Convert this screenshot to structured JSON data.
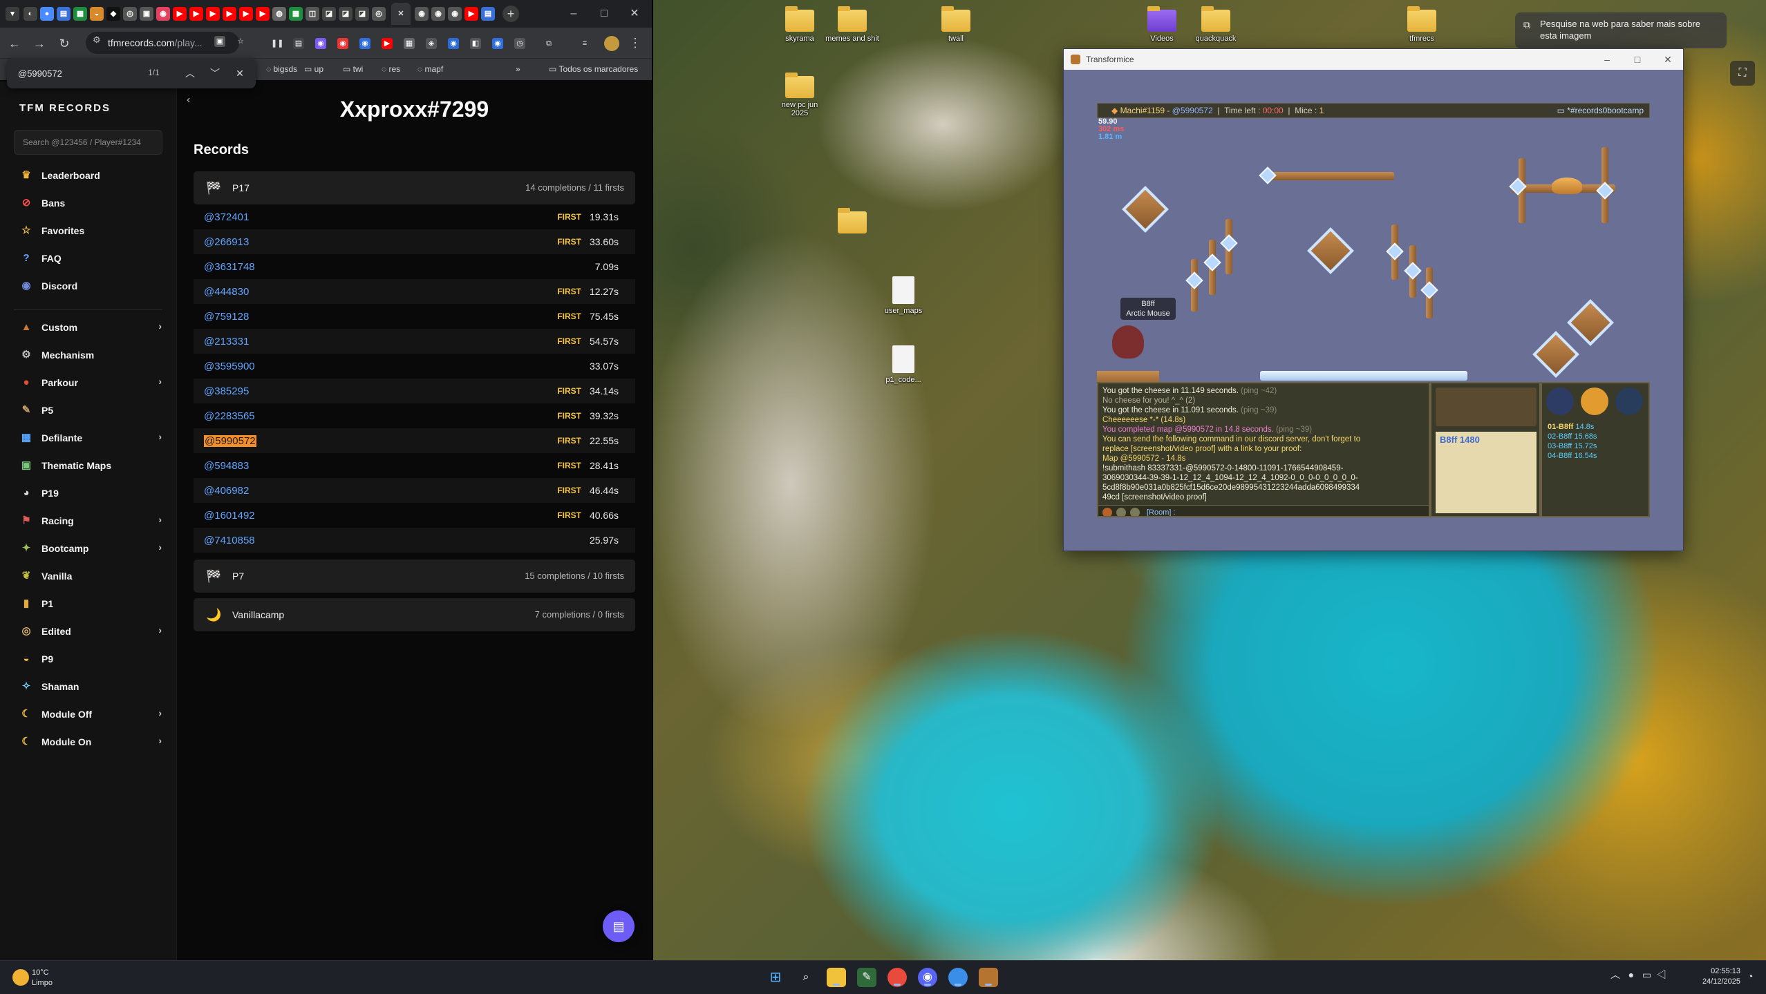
{
  "browser": {
    "url_host": "tfmrecords.com",
    "url_path": "/play...",
    "find": {
      "query": "@5990572",
      "count": "1/1"
    },
    "bookmarks": [
      "bigsds",
      "up",
      "twi",
      "res",
      "mapf"
    ],
    "all_bookmarks": "Todos os marcadores",
    "window_controls": {
      "minimize": "–",
      "maximize": "□",
      "close": "✕"
    }
  },
  "sidebar": {
    "brand": "TFM RECORDS",
    "search_placeholder": "Search @123456 / Player#1234",
    "items_top": [
      {
        "label": "Leaderboard",
        "icon": "crown-icon",
        "glyph": "♛",
        "color": "#f0b43c"
      },
      {
        "label": "Bans",
        "icon": "ban-icon",
        "glyph": "⊘",
        "color": "#ff4d4d"
      },
      {
        "label": "Favorites",
        "icon": "star-icon",
        "glyph": "☆",
        "color": "#f4c542"
      },
      {
        "label": "FAQ",
        "icon": "question-icon",
        "glyph": "?",
        "color": "#6aa3ff"
      },
      {
        "label": "Discord",
        "icon": "discord-icon",
        "glyph": "◉",
        "color": "#7289da"
      }
    ],
    "items_categories": [
      {
        "label": "Custom",
        "icon": "custom-icon",
        "glyph": "▲",
        "color": "#c77a3a",
        "chevron": true
      },
      {
        "label": "Mechanism",
        "icon": "gear-icon",
        "glyph": "⚙",
        "color": "#bdbdbd",
        "chevron": false
      },
      {
        "label": "Parkour",
        "icon": "parkour-icon",
        "glyph": "●",
        "color": "#e0522f",
        "chevron": true
      },
      {
        "label": "P5",
        "icon": "brush-icon",
        "glyph": "✎",
        "color": "#c8a16a",
        "chevron": false
      },
      {
        "label": "Defilante",
        "icon": "defilante-icon",
        "glyph": "▦",
        "color": "#59a7ff",
        "chevron": true
      },
      {
        "label": "Thematic Maps",
        "icon": "map-icon",
        "glyph": "▣",
        "color": "#7cc47c",
        "chevron": false
      },
      {
        "label": "P19",
        "icon": "p19-icon",
        "glyph": "◕",
        "color": "#dcdcdc",
        "chevron": false
      },
      {
        "label": "Racing",
        "icon": "racing-icon",
        "glyph": "⚑",
        "color": "#e05a5a",
        "chevron": true
      },
      {
        "label": "Bootcamp",
        "icon": "bootcamp-icon",
        "glyph": "✦",
        "color": "#9fbf5a",
        "chevron": true
      },
      {
        "label": "Vanilla",
        "icon": "vanilla-icon",
        "glyph": "❦",
        "color": "#c2c23a",
        "chevron": false
      },
      {
        "label": "P1",
        "icon": "lock-icon",
        "glyph": "▮",
        "color": "#e6a93a",
        "chevron": false
      },
      {
        "label": "Edited",
        "icon": "edited-icon",
        "glyph": "◎",
        "color": "#d8b26a",
        "chevron": true
      },
      {
        "label": "P9",
        "icon": "cheese-icon",
        "glyph": "◒",
        "color": "#f0b44a",
        "chevron": false
      },
      {
        "label": "Shaman",
        "icon": "feather-icon",
        "glyph": "✧",
        "color": "#7fd4ff",
        "chevron": false
      },
      {
        "label": "Module Off",
        "icon": "moon-icon",
        "glyph": "☾",
        "color": "#f0c23c",
        "chevron": true
      },
      {
        "label": "Module On",
        "icon": "moon-icon",
        "glyph": "☾",
        "color": "#f0c23c",
        "chevron": true
      }
    ]
  },
  "main": {
    "player": "Xxproxx#7299",
    "section_title": "Records",
    "groups": [
      {
        "name": "P17",
        "stats": "14 completions / 11 firsts",
        "icon": "checkered-flag-icon",
        "glyph": "🏁"
      },
      {
        "name": "P7",
        "stats": "15 completions / 10 firsts",
        "icon": "checkered-flag-icon",
        "glyph": "🏁"
      },
      {
        "name": "Vanillacamp",
        "stats": "7 completions / 0 firsts",
        "icon": "moon-icon",
        "glyph": "🌙"
      }
    ],
    "records": [
      {
        "code": "@372401",
        "first": "FIRST",
        "time": "19.31s"
      },
      {
        "code": "@266913",
        "first": "FIRST",
        "time": "33.60s"
      },
      {
        "code": "@3631748",
        "first": "",
        "time": "7.09s"
      },
      {
        "code": "@444830",
        "first": "FIRST",
        "time": "12.27s"
      },
      {
        "code": "@759128",
        "first": "FIRST",
        "time": "75.45s"
      },
      {
        "code": "@213331",
        "first": "FIRST",
        "time": "54.57s"
      },
      {
        "code": "@3595900",
        "first": "",
        "time": "33.07s"
      },
      {
        "code": "@385295",
        "first": "FIRST",
        "time": "34.14s"
      },
      {
        "code": "@2283565",
        "first": "FIRST",
        "time": "39.32s"
      },
      {
        "code": "@5990572",
        "first": "FIRST",
        "time": "22.55s",
        "highlight": true
      },
      {
        "code": "@594883",
        "first": "FIRST",
        "time": "28.41s"
      },
      {
        "code": "@406982",
        "first": "FIRST",
        "time": "46.44s"
      },
      {
        "code": "@1601492",
        "first": "FIRST",
        "time": "40.66s"
      },
      {
        "code": "@7410858",
        "first": "",
        "time": "25.97s"
      }
    ]
  },
  "desktop": {
    "icons": [
      {
        "label": "skyrama",
        "type": "folder"
      },
      {
        "label": "memes and shit",
        "type": "folder"
      },
      {
        "label": "twall",
        "type": "folder"
      },
      {
        "label": "Videos",
        "type": "folder"
      },
      {
        "label": "quackquack",
        "type": "folder"
      },
      {
        "label": "tfmrecs",
        "type": "folder"
      },
      {
        "label": "new pc jun 2025",
        "type": "folder"
      },
      {
        "label": "user_maps",
        "type": "file"
      },
      {
        "label": "p1_code...",
        "type": "file"
      }
    ],
    "lens_hint": "Pesquise na web para saber mais sobre esta imagem"
  },
  "game": {
    "title": "Transformice",
    "hud": {
      "player": "Machi#1159",
      "map": "@5990572",
      "time_label": "Time left :",
      "time_value": "00:00",
      "mice_label": "Mice :",
      "mice_value": "1",
      "room": "*#records0bootcamp"
    },
    "coords": [
      "59.90",
      "302 ms",
      "1.81 m"
    ],
    "mouse_tag": {
      "name": "B8ff",
      "title": "Arctic Mouse"
    },
    "chat": [
      {
        "text": "You got the cheese in 11.149 seconds.",
        "suffix": " (ping ~42)",
        "cls": "c-white"
      },
      {
        "text": "No cheese for you! ^_^ (2)",
        "suffix": "",
        "cls": "c-gray"
      },
      {
        "text": "You got the cheese in 11.091 seconds.",
        "suffix": " (ping ~39)",
        "cls": "c-white"
      },
      {
        "text": "Cheeeeeese *-* (14.8s)",
        "suffix": "",
        "cls": "c-yellow"
      },
      {
        "text": "You completed map @5990572 in 14.8 seconds.",
        "suffix": " (ping ~39)",
        "cls": "c-pink"
      },
      {
        "text": "You can send the following command in our discord server, don't forget to",
        "suffix": "",
        "cls": "c-yellow"
      },
      {
        "text": "replace [screenshot/video proof] with a link to your proof:",
        "suffix": "",
        "cls": "c-yellow"
      },
      {
        "text": "Map @5990572 - 14.8s",
        "suffix": "",
        "cls": "c-yellow"
      },
      {
        "text": "!submithash 83337331-@5990572-0-14800-11091-1766544908459-",
        "suffix": "",
        "cls": "c-white"
      },
      {
        "text": "3069030344-39-39-1-12_12_4_1094-12_12_4_1092-0_0_0-0_0_0_0_0-",
        "suffix": "",
        "cls": "c-white"
      },
      {
        "text": "5cd8f8b90e031a0b825fcf15d6ce20de98995431223244adda6098499334",
        "suffix": "",
        "cls": "c-white"
      },
      {
        "text": "49cd [screenshot/video proof]",
        "suffix": "",
        "cls": "c-white"
      }
    ],
    "chat_input": "[Room] :",
    "tribe_score": "B8ff 1480",
    "ranking": [
      {
        "rank": "01-B8ff",
        "time": "14.8s"
      },
      {
        "rank": "02-B8ff",
        "time": "15.68s"
      },
      {
        "rank": "03-B8ff",
        "time": "15.72s"
      },
      {
        "rank": "04-B8ff",
        "time": "16.54s"
      }
    ]
  },
  "taskbar": {
    "temp": "10°C",
    "weather": "Limpo",
    "time": "02:55:13",
    "date": "24/12/2025"
  }
}
